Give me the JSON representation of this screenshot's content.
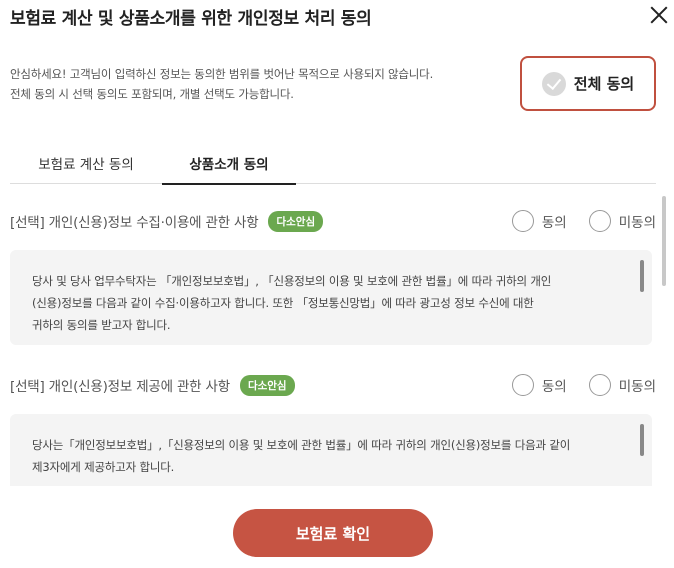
{
  "header": {
    "title": "보험료 계산 및 상품소개를 위한 개인정보 처리 동의"
  },
  "intro": {
    "line1": "안심하세요! 고객님이 입력하신 정보는 동의한 범위를 벗어난 목적으로 사용되지 않습니다.",
    "line2": "전체 동의 시 선택 동의도 포함되며, 개별 선택도 가능합니다."
  },
  "all_agree": {
    "label": "전체 동의"
  },
  "tabs": [
    {
      "label": "보험료 계산 동의",
      "active": false
    },
    {
      "label": "상품소개 동의",
      "active": true
    }
  ],
  "sections": [
    {
      "title": "[선택] 개인(신용)정보 수집·이용에 관한 사항",
      "badge": "다소안심",
      "agree_label": "동의",
      "disagree_label": "미동의",
      "body_lines": [
        "당사 및 당사 업무수탁자는 「개인정보보호법」, 「신용정보의 이용 및 보호에 관한 법률」에 따라 귀하의 개인",
        "(신용)정보를 다음과 같이 수집·이용하고자 합니다. 또한 「정보통신망법」에 따라 광고성 정보 수신에 대한",
        "귀하의 동의를 받고자 합니다."
      ]
    },
    {
      "title": "[선택] 개인(신용)정보 제공에 관한 사항",
      "badge": "다소안심",
      "agree_label": "동의",
      "disagree_label": "미동의",
      "body_lines": [
        "당사는「개인정보보호법」,「신용정보의 이용 및 보호에 관한 법률」에 따라 귀하의 개인(신용)정보를 다음과 같이",
        "제3자에게 제공하고자 합니다."
      ]
    }
  ],
  "footer": {
    "confirm_label": "보험료 확인"
  },
  "colors": {
    "accent": "#c65443",
    "badge": "#6ba84f"
  }
}
